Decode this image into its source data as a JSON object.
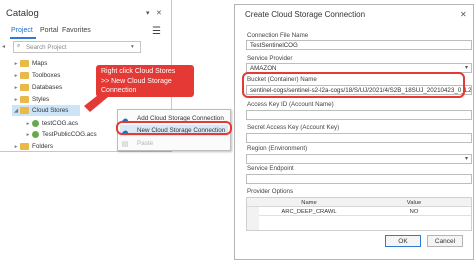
{
  "catalog": {
    "title": "Catalog",
    "window_controls": [
      "▾",
      "✕"
    ],
    "tabs": [
      "Project",
      "Portal",
      "Favorites"
    ],
    "search_placeholder": "Search Project",
    "tree": [
      {
        "label": "Maps",
        "icon": "folder"
      },
      {
        "label": "Toolboxes",
        "icon": "folder"
      },
      {
        "label": "Databases",
        "icon": "folder"
      },
      {
        "label": "Styles",
        "icon": "folder"
      },
      {
        "label": "Cloud Stores",
        "icon": "folder",
        "expanded": true,
        "selected": true
      },
      {
        "label": "testCOG.acs",
        "icon": "globe",
        "child": true
      },
      {
        "label": "TestPublicCOG.acs",
        "icon": "globe",
        "child": true
      },
      {
        "label": "Folders",
        "icon": "folder"
      }
    ]
  },
  "context_menu": {
    "items": [
      "Add Cloud Storage Connection",
      "New Cloud Storage Connection",
      "Paste"
    ]
  },
  "callout": {
    "lines": [
      "Right click Cloud Stores",
      ">> New Cloud Storage",
      "Connection"
    ]
  },
  "dialog": {
    "title": "Create Cloud Storage Connection",
    "close": "✕",
    "connection_file_name_label": "Connection File Name",
    "connection_file_name_value": "TestSentinelCOG",
    "service_provider_label": "Service Provider",
    "service_provider_value": "AMAZON",
    "bucket_label": "Bucket (Container) Name",
    "bucket_value": "sentinel-cogs/sentinel-s2-l2a-cogs/18/S/UJ/2021/4/S2B_18SUJ_20210423_0_L2A",
    "access_key_label": "Access Key ID (Account Name)",
    "secret_key_label": "Secret Access Key (Account Key)",
    "region_label": "Region (Environment)",
    "endpoint_label": "Service Endpoint",
    "provider_options_label": "Provider Options",
    "grid_headers": [
      "Name",
      "Value"
    ],
    "grid_rows": [
      [
        "ARC_DEEP_CRAWL",
        "NO"
      ]
    ],
    "ok": "OK",
    "cancel": "Cancel"
  },
  "colors": {
    "accent": "#2e7bcf",
    "highlight": "#e53935",
    "selection": "#cce4f7"
  }
}
